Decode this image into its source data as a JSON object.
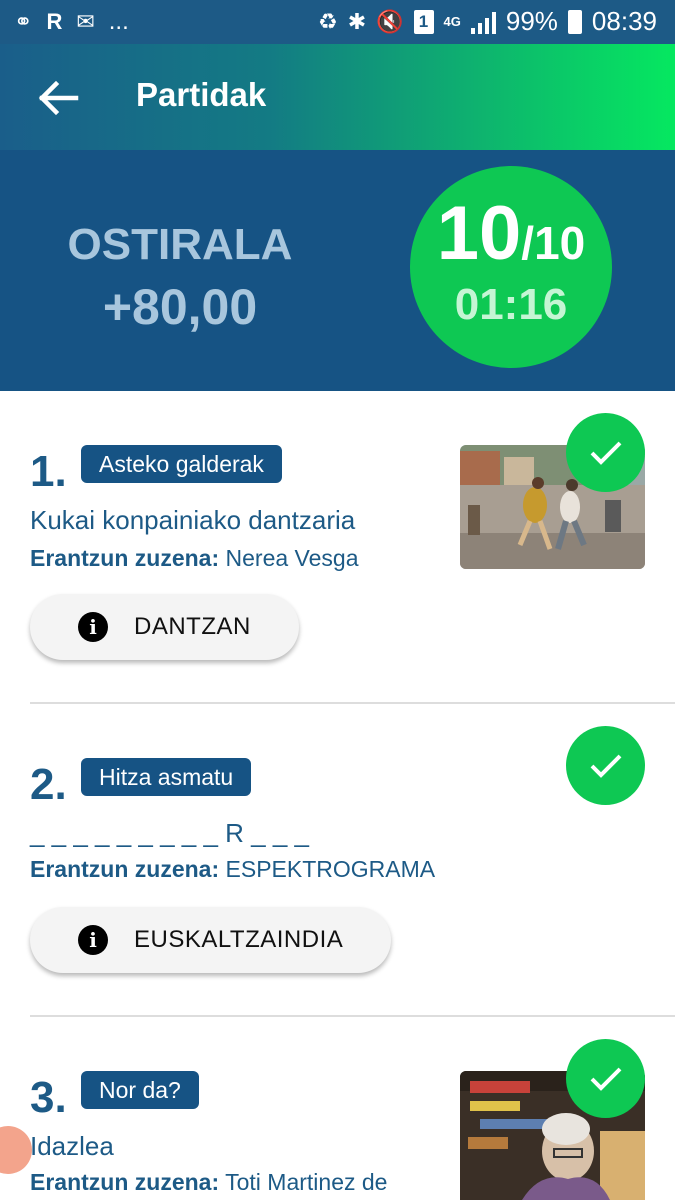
{
  "status_bar": {
    "left_icons": [
      "cast-icon",
      "app-r-icon",
      "mail-icon"
    ],
    "more": "...",
    "sim": "1",
    "network": "4G",
    "battery": "99%",
    "time": "08:39"
  },
  "app_bar": {
    "title": "Partidak"
  },
  "score": {
    "day": "OSTIRALA",
    "points": "+80,00",
    "correct": "10",
    "total": "/10",
    "time": "01:16"
  },
  "answer_label": "Erantzun zuzena:",
  "questions": [
    {
      "number": "1.",
      "category": "Asteko galderak",
      "text": "Kukai konpainiako dantzaria",
      "answer": "Nerea Vesga",
      "button": "DANTZAN",
      "correct": true
    },
    {
      "number": "2.",
      "category": "Hitza asmatu",
      "text": "_ _ _ _ _ _ _ _ _ R _ _ _",
      "answer": "ESPEKTROGRAMA",
      "button": "EUSKALTZAINDIA",
      "correct": true
    },
    {
      "number": "3.",
      "category": "Nor da?",
      "text": "Idazlea",
      "answer": "Toti Martinez de",
      "correct": true
    }
  ],
  "colors": {
    "primary": "#165384",
    "accent_green": "#0ec853",
    "text_blue": "#1d5a86"
  }
}
